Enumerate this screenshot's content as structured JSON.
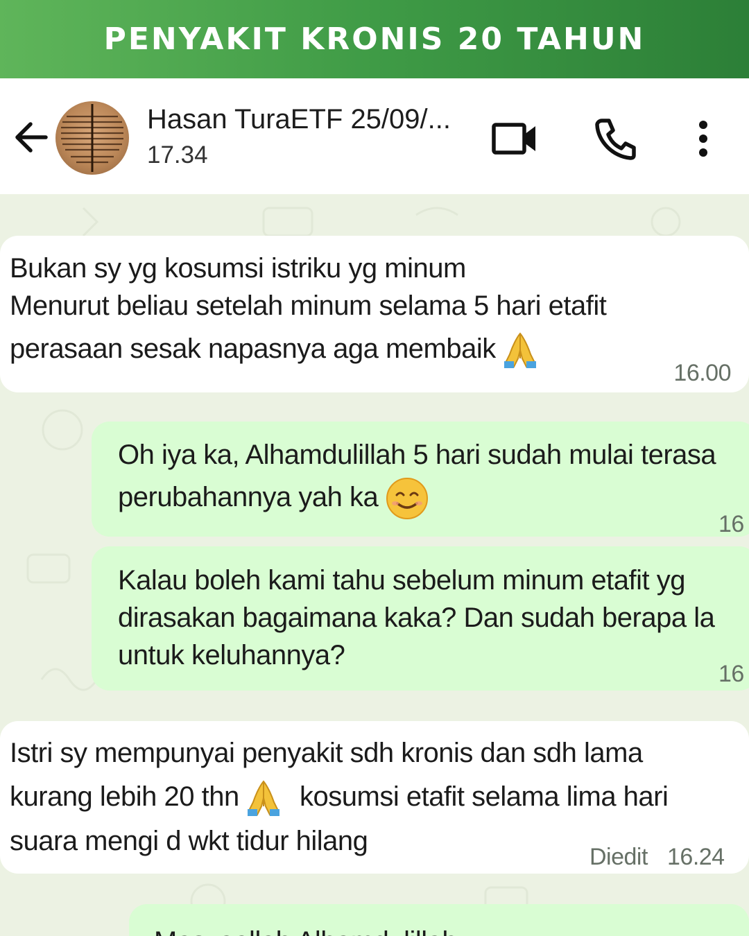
{
  "banner": {
    "title": "PENYAKIT KRONIS 20 TAHUN"
  },
  "header": {
    "contact_name": "Hasan TuraETF 25/09/...",
    "status": "17.34"
  },
  "messages": [
    {
      "direction": "incoming",
      "lines": [
        "Bukan sy yg kosumsi istriku yg minum",
        "Menurut beliau setelah minum selama 5 hari etafit",
        "perasaan sesak napasnya aga membaik"
      ],
      "time": "16.00"
    },
    {
      "direction": "outgoing",
      "lines": [
        "Oh iya ka, Alhamdulillah 5 hari sudah mulai terasa",
        "perubahannya yah ka"
      ],
      "time": "16"
    },
    {
      "direction": "outgoing",
      "lines": [
        "Kalau boleh kami tahu sebelum minum etafit yg",
        "dirasakan bagaimana kaka? Dan sudah berapa la",
        "untuk keluhannya?"
      ],
      "time": "16"
    },
    {
      "direction": "incoming",
      "lines": [
        "Istri sy mempunyai penyakit sdh kronis dan sdh lama",
        "kurang lebih 20 thn",
        "kosumsi etafit selama lima hari",
        "suara mengi d wkt tidur hilang"
      ],
      "edited": "Diedit",
      "time": "16.24"
    },
    {
      "direction": "outgoing",
      "lines": [
        "Masyaallah Alhamdulillah"
      ]
    }
  ],
  "colors": {
    "banner_left": "#5fb55a",
    "banner_right": "#2c7f37",
    "incoming_bubble": "#ffffff",
    "outgoing_bubble": "#d9fdd3"
  },
  "icons": [
    "arrow-back-icon",
    "video-call-icon",
    "phone-icon",
    "more-vert-icon",
    "folded-hands-emoji",
    "smiling-face-emoji"
  ]
}
